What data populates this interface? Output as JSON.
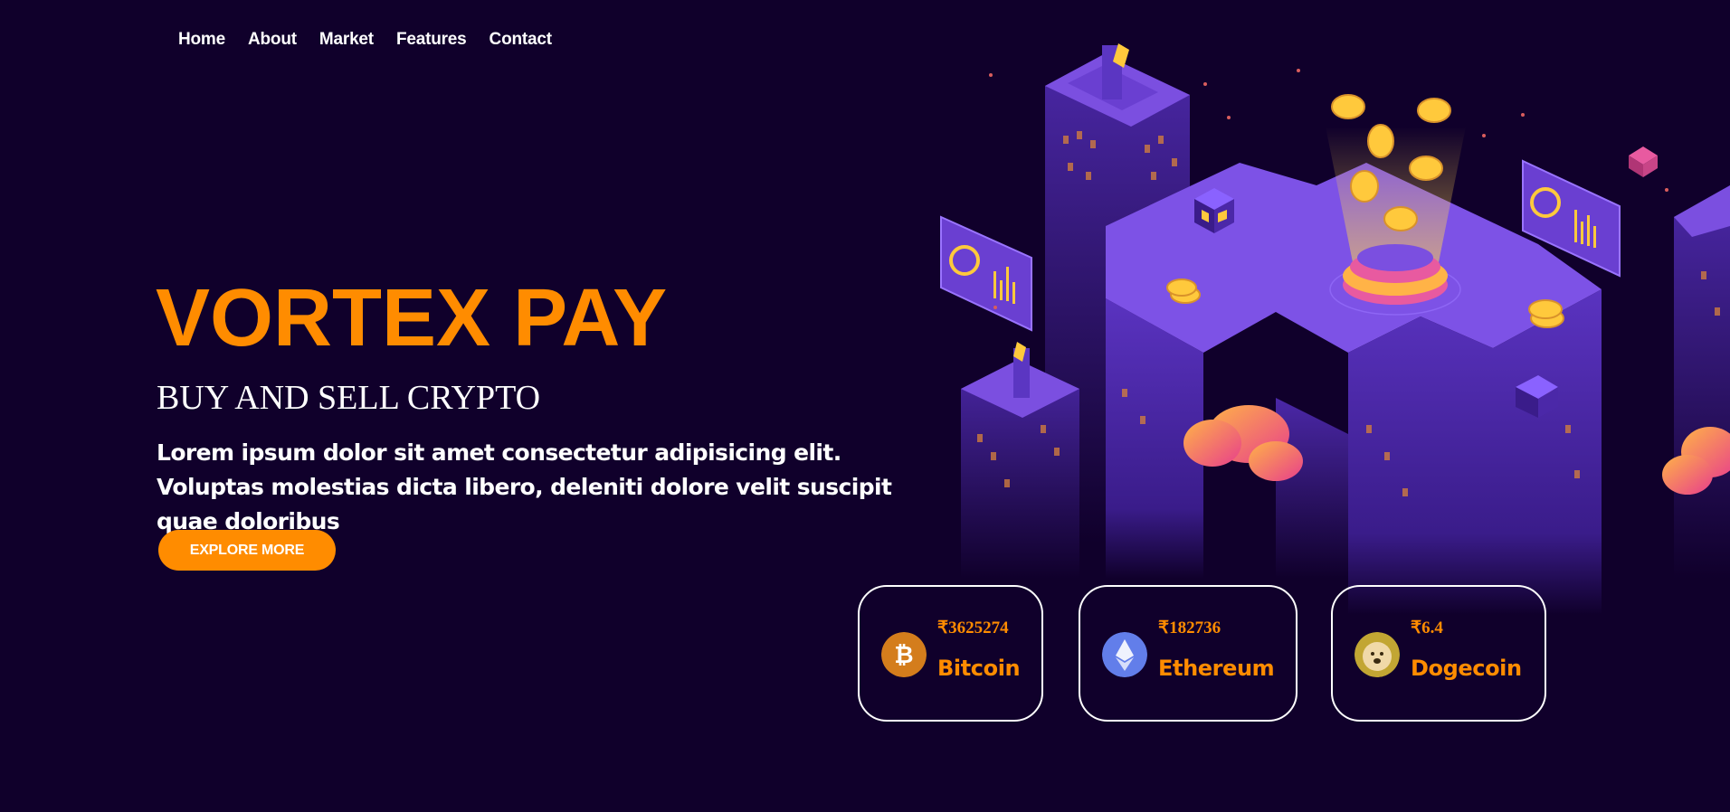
{
  "nav": {
    "items": [
      "Home",
      "About",
      "Market",
      "Features",
      "Contact"
    ]
  },
  "hero": {
    "title": "VORTEX PAY",
    "subtitle": "BUY AND SELL CRYPTO",
    "text": "Lorem ipsum dolor sit amet consectetur adipisicing elit. Voluptas molestias dicta libero, deleniti dolore velit suscipit quae doloribus",
    "button": "EXPLORE MORE"
  },
  "coins": [
    {
      "price": "₹3625274",
      "name": "Bitcoin",
      "icon": "bitcoin-icon",
      "color": "#f7931a"
    },
    {
      "price": "₹182736",
      "name": "Ethereum",
      "icon": "ethereum-icon",
      "color": "#627eea"
    },
    {
      "price": "₹6.4",
      "name": "Dogecoin",
      "icon": "dogecoin-icon",
      "color": "#c2a633"
    }
  ],
  "colors": {
    "background": "#10002b",
    "accent": "#ff8c00",
    "purple": "#6a3fd1"
  }
}
